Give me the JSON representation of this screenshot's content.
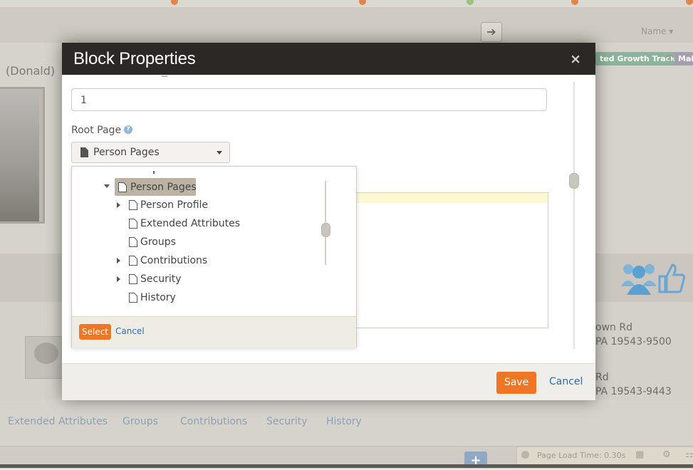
{
  "header": {
    "name_dropdown": "Name",
    "name_caret": "▾",
    "login_icon": "arrow-circle-icon"
  },
  "person": {
    "name_suffix": "(Donald)",
    "badges": {
      "growth_track": "ted Growth Track",
      "member": "Mai"
    },
    "addresses": [
      {
        "line1": "own Rd",
        "line2": "PA 19543-9500"
      },
      {
        "line1": "Rd",
        "line2": "PA 19543-9443"
      }
    ]
  },
  "subnav": {
    "tabs": [
      "Extended Attributes",
      "Groups",
      "Contributions",
      "Security",
      "History"
    ]
  },
  "footer": {
    "add_label": "+",
    "page_load_time": "Page Load Time: 0.30s"
  },
  "modal": {
    "title": "Block Properties",
    "close_label": "×",
    "number_value": "1",
    "root_page_label": "Root Page",
    "help_label": "?",
    "root_page_value": "Person Pages",
    "save_label": "Save",
    "cancel_label": "Cancel"
  },
  "tree": {
    "items": [
      {
        "label": "Person Pages",
        "level": 0,
        "expanded": true,
        "selected": true
      },
      {
        "label": "Person Profile",
        "level": 1,
        "has_children": true
      },
      {
        "label": "Extended Attributes",
        "level": 1,
        "has_children": false
      },
      {
        "label": "Groups",
        "level": 1,
        "has_children": false
      },
      {
        "label": "Contributions",
        "level": 1,
        "has_children": true
      },
      {
        "label": "Security",
        "level": 1,
        "has_children": true
      },
      {
        "label": "History",
        "level": 1,
        "has_children": false
      }
    ],
    "select_label": "Select",
    "cancel_label": "Cancel"
  },
  "colors": {
    "modal_header": "#2b2826",
    "accent_orange": "#ee7625",
    "link_blue": "#2a6ebb",
    "selected_node": "#bdb3a4"
  }
}
